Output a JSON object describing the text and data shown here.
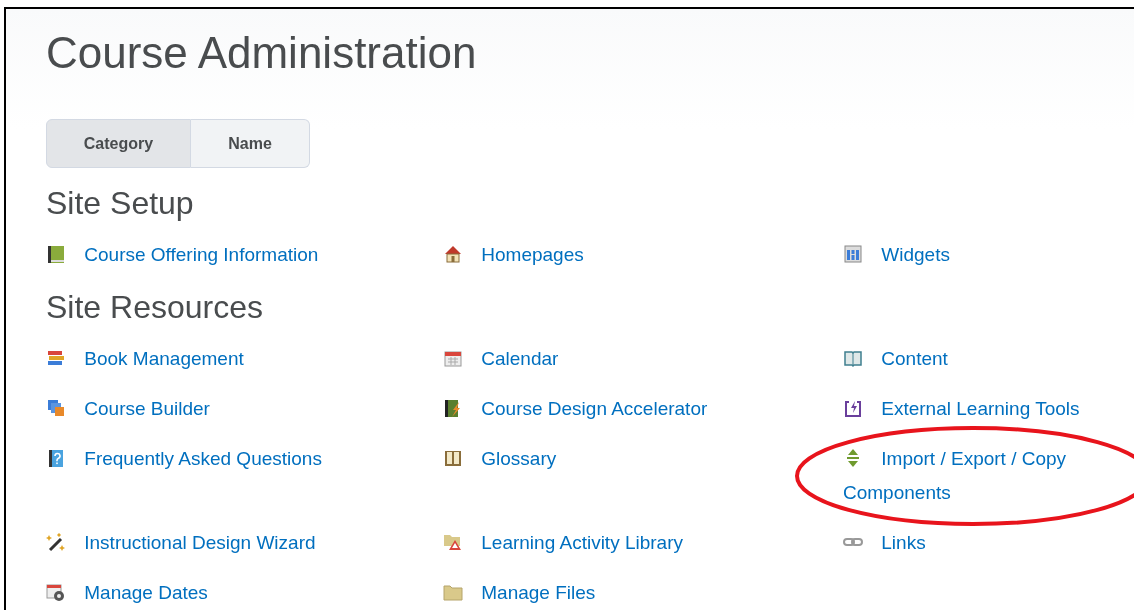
{
  "page_title": "Course Administration",
  "view_toggle": [
    {
      "label": "Category",
      "selected": true
    },
    {
      "label": "Name",
      "selected": false
    }
  ],
  "sections": [
    {
      "heading": "Site Setup",
      "tools": [
        {
          "label": "Course Offering Information"
        },
        {
          "label": "Homepages"
        },
        {
          "label": "Widgets"
        }
      ]
    },
    {
      "heading": "Site Resources",
      "tools": [
        {
          "label": "Book Management"
        },
        {
          "label": "Calendar"
        },
        {
          "label": "Content"
        },
        {
          "label": "Course Builder"
        },
        {
          "label": "Course Design Accelerator"
        },
        {
          "label": "External Learning Tools"
        },
        {
          "label": "Frequently Asked Questions"
        },
        {
          "label": "Glossary"
        },
        {
          "label": "Import / Export / Copy Components",
          "highlighted": true
        },
        {
          "label": "Instructional Design Wizard"
        },
        {
          "label": "Learning Activity Library"
        },
        {
          "label": "Links"
        },
        {
          "label": "Manage Dates"
        },
        {
          "label": "Manage Files"
        }
      ]
    }
  ]
}
